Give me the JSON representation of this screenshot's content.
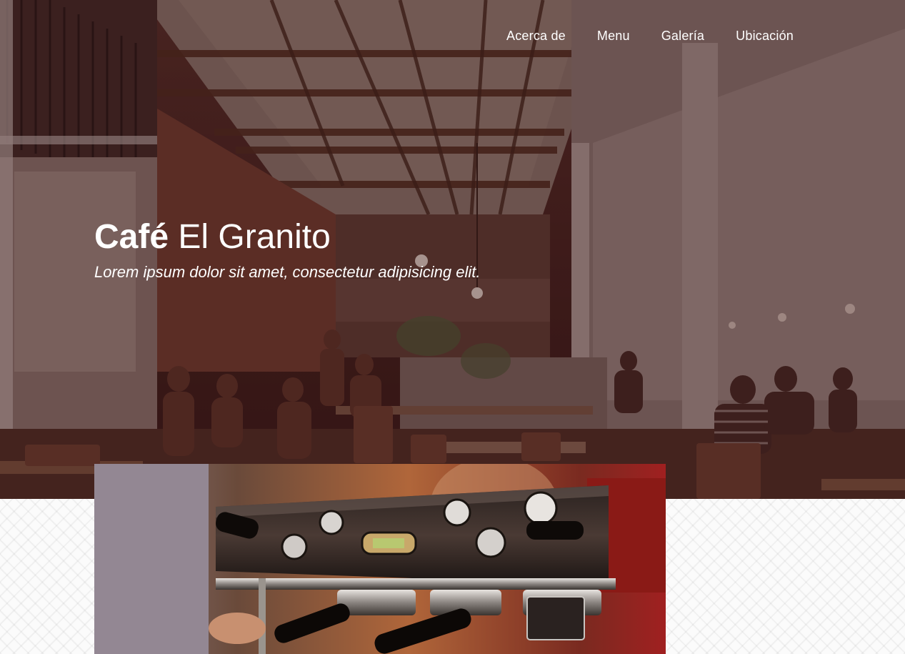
{
  "nav": {
    "items": [
      {
        "label": "Acerca de"
      },
      {
        "label": "Menu"
      },
      {
        "label": "Galería"
      },
      {
        "label": "Ubicación"
      }
    ]
  },
  "hero": {
    "title_bold": "Café",
    "title_light": "El Granito",
    "tagline": "Lorem ipsum dolor sit amet, consectetur adipisicing elit."
  },
  "colors": {
    "overlay": "#3c1414",
    "text": "#ffffff",
    "pattern_bg": "#fbfbfb"
  }
}
